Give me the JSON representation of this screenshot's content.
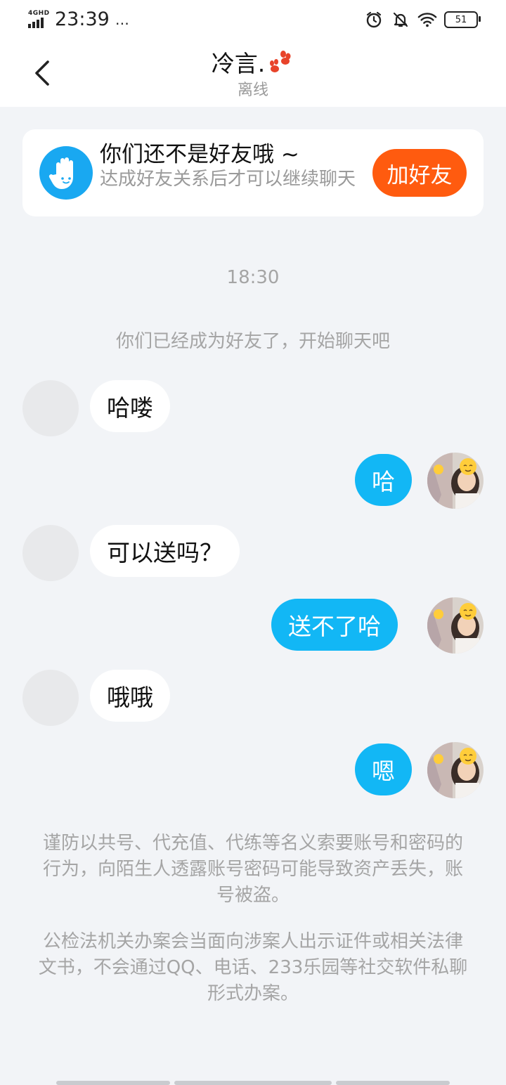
{
  "status_bar": {
    "network": "4GHD",
    "time": "23:39",
    "more": "…",
    "battery": "51",
    "icons": [
      "alarm-icon",
      "bell-muted-icon",
      "wifi-icon",
      "battery-icon"
    ]
  },
  "nav": {
    "title": "冷言.",
    "subtitle": "离线",
    "back_icon": "chevron-left-icon"
  },
  "friend_card": {
    "title": "你们还不是好友哦 ~",
    "desc": "达成好友关系后才可以继续聊天",
    "button": "加好友",
    "button_color": "#ff5b0f"
  },
  "chat": {
    "time": "18:30",
    "system": "你们已经成为好友了，开始聊天吧",
    "messages": [
      {
        "from": "other",
        "text": "哈喽"
      },
      {
        "from": "me",
        "text": "哈"
      },
      {
        "from": "other",
        "text": "可以送吗？"
      },
      {
        "from": "me",
        "text": "送不了哈"
      },
      {
        "from": "other",
        "text": "哦哦"
      },
      {
        "from": "me",
        "text": "嗯"
      }
    ]
  },
  "notices": {
    "warning": "谨防以共号、代充值、代练等名义索要账号和密码的行为，向陌生人透露账号密码可能导致资产丢失，账号被盗。",
    "police": "公检法机关办案会当面向涉案人出示证件或相关法律文书，不会通过QQ、电话、233乐园等社交软件私聊形式办案。"
  },
  "colors": {
    "accent_blue": "#12b7f5",
    "background": "#f2f4f7",
    "muted_text": "#a5a5a5"
  }
}
